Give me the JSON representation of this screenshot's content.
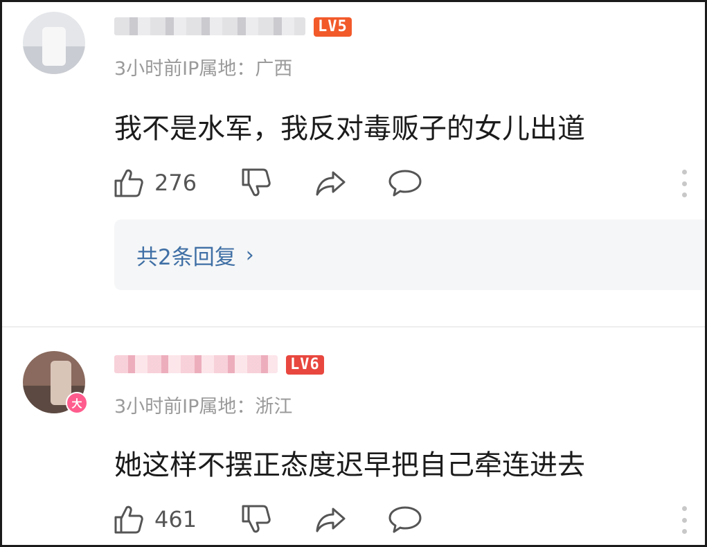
{
  "comments": [
    {
      "level": "LV5",
      "meta": "3小时前IP属地：广西",
      "text": "我不是水军，我反对毒贩子的女儿出道",
      "likes": "276",
      "replies_label": "共2条回复",
      "replies_chevron": "›"
    },
    {
      "level": "LV6",
      "vip_badge": "大",
      "meta": "3小时前IP属地：浙江",
      "text": "她这样不摆正态度迟早把自己牵连进去",
      "likes": "461"
    }
  ],
  "icons": {
    "like": "thumbs-up-icon",
    "dislike": "thumbs-down-icon",
    "share": "share-arrow-icon",
    "reply": "speech-bubble-icon",
    "more": "vertical-dots-icon"
  },
  "colors": {
    "level_badge": "#f25a2a",
    "link": "#3f6fa5",
    "meta": "#9a9a9a",
    "vip_badge": "#ff5c8d"
  }
}
